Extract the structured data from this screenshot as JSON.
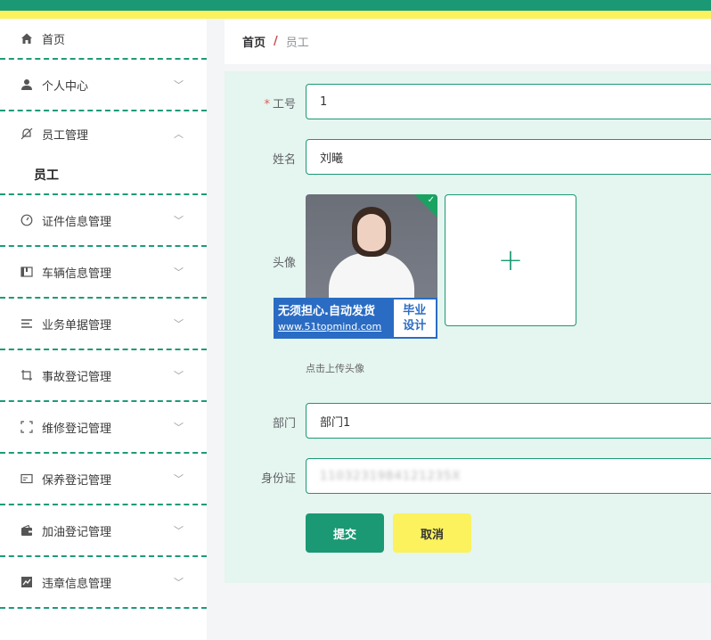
{
  "sidebar": {
    "items": [
      {
        "label": "首页",
        "icon": "home-icon"
      },
      {
        "label": "个人中心",
        "icon": "user-icon"
      },
      {
        "label": "员工管理",
        "icon": "bell-off-icon"
      },
      {
        "label": "证件信息管理",
        "icon": "gauge-icon"
      },
      {
        "label": "车辆信息管理",
        "icon": "book-icon"
      },
      {
        "label": "业务单据管理",
        "icon": "list-icon"
      },
      {
        "label": "事故登记管理",
        "icon": "crop-icon"
      },
      {
        "label": "维修登记管理",
        "icon": "frame-icon"
      },
      {
        "label": "保养登记管理",
        "icon": "card-icon"
      },
      {
        "label": "加油登记管理",
        "icon": "wallet-icon"
      },
      {
        "label": "违章信息管理",
        "icon": "chart-icon"
      }
    ],
    "submenu": {
      "label": "员工"
    }
  },
  "breadcrumb": {
    "home": "首页",
    "separator": "/",
    "current": "员工"
  },
  "form": {
    "employee_no": {
      "label": "工号",
      "required_mark": "*",
      "value": "1"
    },
    "name": {
      "label": "姓名",
      "value": "刘曦"
    },
    "avatar": {
      "label": "头像",
      "hint": "点击上传头像",
      "upload_symbol": "+"
    },
    "watermark": {
      "line1": "无须担心.自动发货",
      "line2": "www.51topmind.com",
      "tag1": "毕业",
      "tag2": "设计"
    },
    "department": {
      "label": "部门",
      "value": "部门1"
    },
    "id_card": {
      "label": "身份证",
      "value": "1103231984121235X"
    },
    "submit_label": "提交",
    "cancel_label": "取消"
  },
  "colors": {
    "primary": "#1a9974",
    "accent": "#fbf25d",
    "panel": "#e5f5ef"
  }
}
